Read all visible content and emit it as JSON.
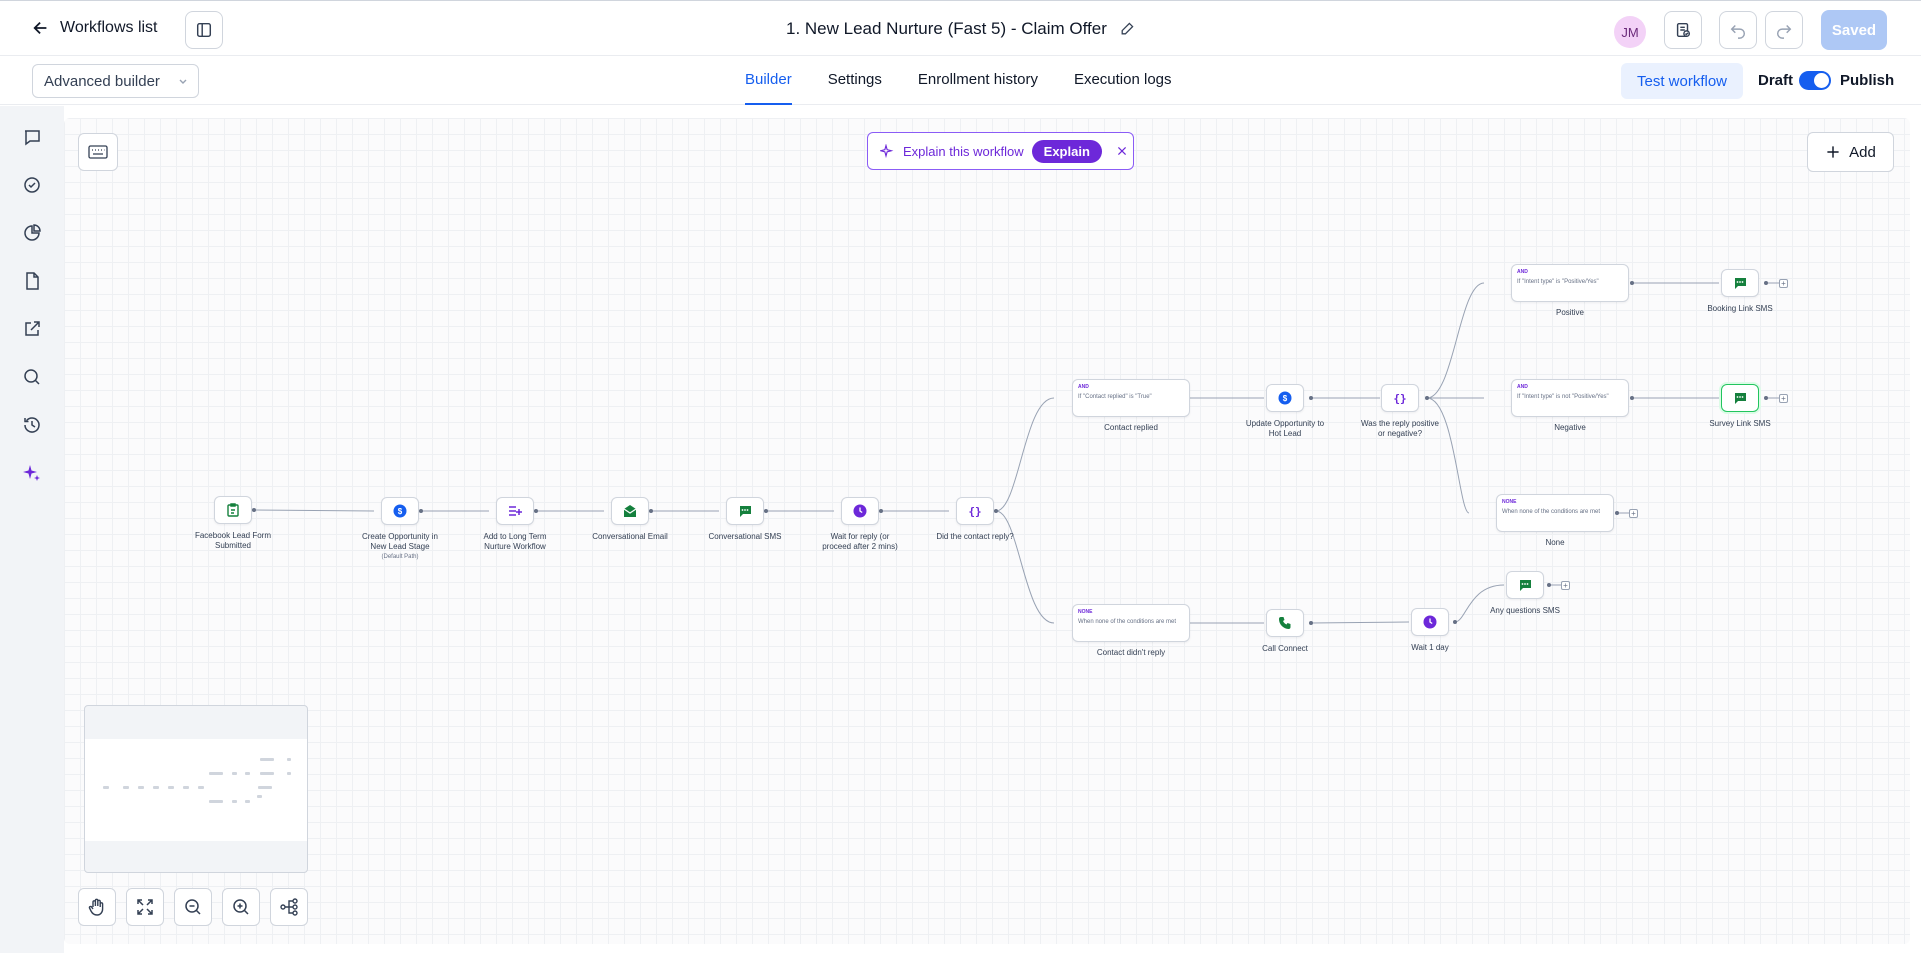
{
  "header": {
    "back_label": "Workflows list",
    "workflow_title": "1. New Lead Nurture (Fast 5) - Claim Offer",
    "avatar_initials": "JM",
    "saved_label": "Saved"
  },
  "subbar": {
    "builder_mode": "Advanced builder",
    "tabs": [
      {
        "label": "Builder",
        "active": true
      },
      {
        "label": "Settings",
        "active": false
      },
      {
        "label": "Enrollment history",
        "active": false
      },
      {
        "label": "Execution logs",
        "active": false
      }
    ],
    "test_label": "Test workflow",
    "draft_label": "Draft",
    "publish_label": "Publish",
    "publish_enabled": true
  },
  "canvas": {
    "explain_text": "Explain this workflow",
    "explain_button": "Explain",
    "add_label": "Add",
    "nodes": {
      "trigger": "Facebook Lead Form Submitted",
      "create_opp": "Create Opportunity in New Lead Stage",
      "create_opp_sub": "(Default Path)",
      "add_long_term": "Add to Long Term Nurture Workflow",
      "conv_email": "Conversational Email",
      "conv_sms": "Conversational SMS",
      "wait_reply": "Wait for reply (or proceed after 2 mins)",
      "did_reply": "Did the contact reply?",
      "contact_replied": "Contact replied",
      "update_opp": "Update Opportunity to Hot Lead",
      "reply_pos_neg": "Was the reply positive or negative?",
      "positive": "Positive",
      "negative": "Negative",
      "none_branch": "None",
      "booking_sms": "Booking Link SMS",
      "survey_sms": "Survey Link SMS",
      "contact_didnt_reply": "Contact didn't reply",
      "call_connect": "Call Connect",
      "wait_1_day": "Wait 1 day",
      "any_questions": "Any questions SMS"
    },
    "conditions": {
      "replied_tag": "AND",
      "replied_text": "If \"Contact replied\" is \"True\"",
      "positive_tag": "AND",
      "positive_text": "If \"Intent type\" is \"Positive/Yes\"",
      "negative_tag": "AND",
      "negative_text": "If \"Intent type\" is not \"Positive/Yes\"",
      "none_tag": "NONE",
      "none_text": "When none of the conditions are met",
      "noreply_tag": "NONE",
      "noreply_text": "When none of the conditions are met"
    }
  },
  "colors": {
    "accent_blue": "#155eef",
    "purple": "#6d28d9",
    "sms_green": "#15803d"
  }
}
